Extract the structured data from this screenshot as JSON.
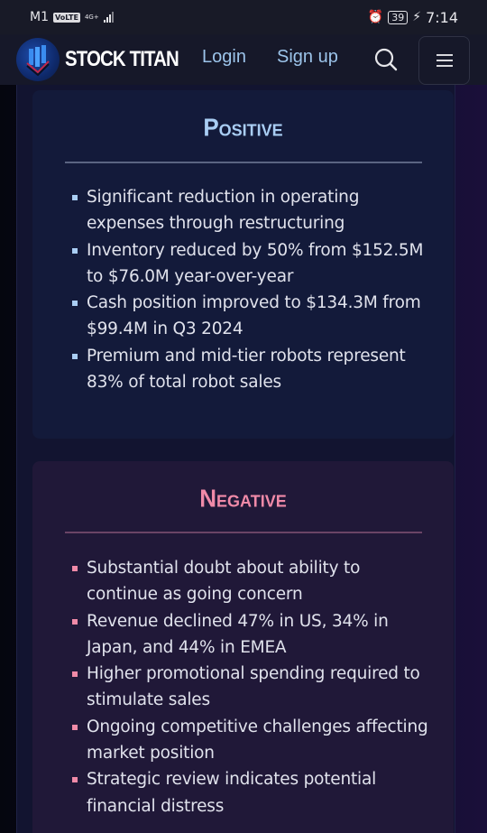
{
  "status_bar": {
    "carrier": "M1",
    "volte": "VoLTE",
    "network": "4G+",
    "battery": "39",
    "time": "7:14"
  },
  "nav": {
    "brand": "STOCK TITAN",
    "login": "Login",
    "signup": "Sign up",
    "search_icon": "search-icon",
    "menu_icon": "hamburger-menu-icon"
  },
  "positive": {
    "title": "Positive",
    "accent": "#a9cdf3",
    "items": [
      "Significant reduction in operating expenses through restructuring",
      "Inventory reduced by 50% from $152.5M to $76.0M year-over-year",
      "Cash position improved to $134.3M from $99.4M in Q3 2024",
      "Premium and mid-tier robots represent 83% of total robot sales"
    ]
  },
  "negative": {
    "title": "Negative",
    "accent": "#f08aa8",
    "items": [
      "Substantial doubt about ability to continue as going concern",
      "Revenue declined 47% in US, 34% in Japan, and 44% in EMEA",
      "Higher promotional spending required to stimulate sales",
      "Ongoing competitive challenges affecting market position",
      "Strategic review indicates potential financial distress"
    ]
  }
}
